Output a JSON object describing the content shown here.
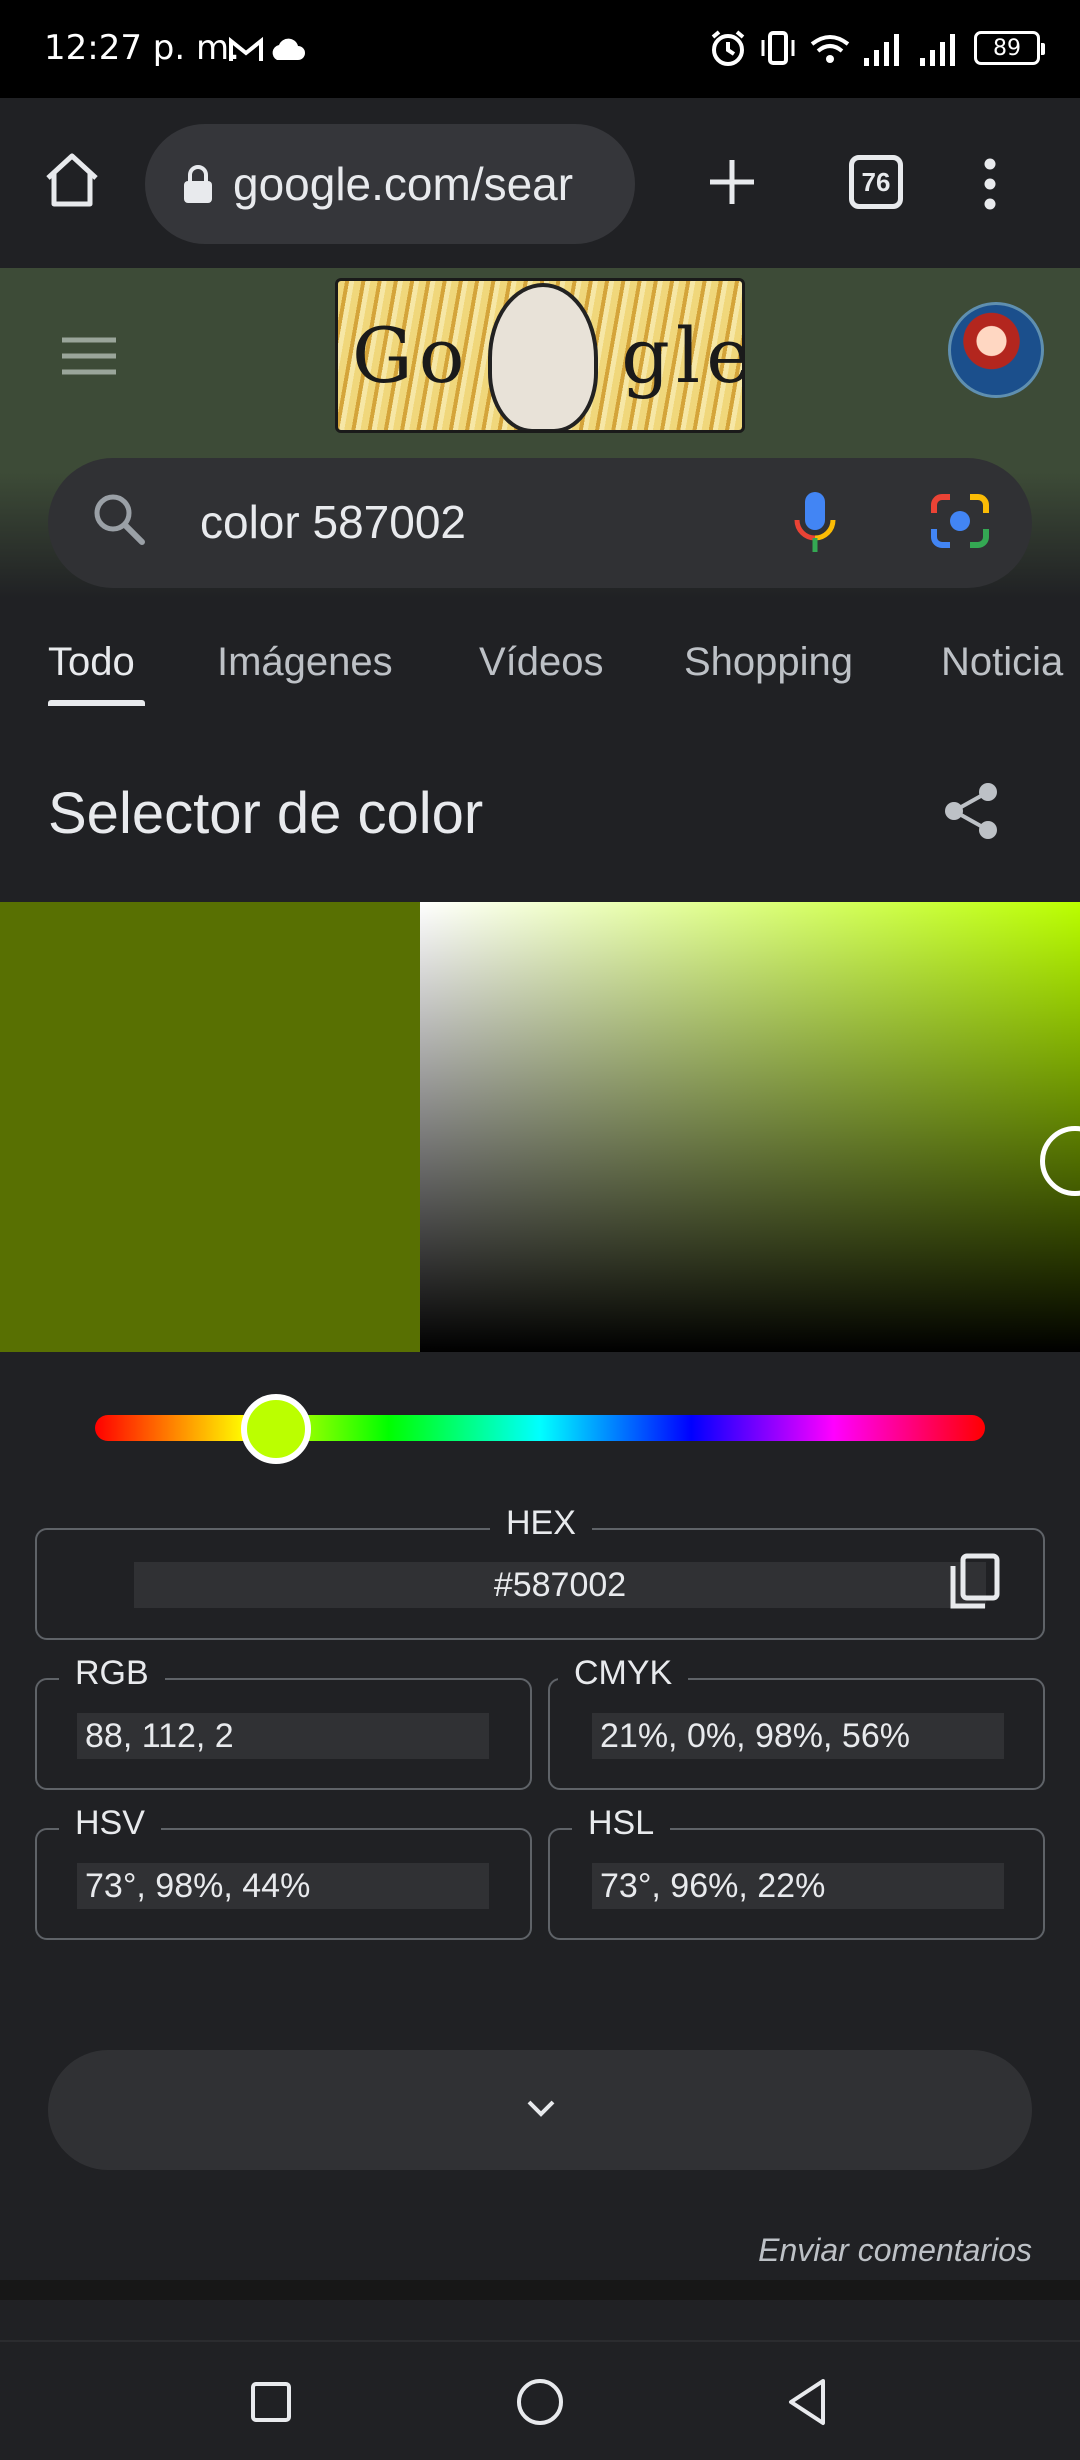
{
  "status_bar": {
    "time": "12:27 p. m.",
    "battery": "89"
  },
  "browser": {
    "url": "google.com/sear",
    "tab_count": "76"
  },
  "search": {
    "query": "color 587002"
  },
  "tabs": [
    {
      "label": "Todo",
      "active": true
    },
    {
      "label": "Imágenes"
    },
    {
      "label": "Vídeos"
    },
    {
      "label": "Shopping"
    },
    {
      "label": "Noticia"
    }
  ],
  "picker": {
    "title": "Selector de color",
    "selected_color": "#587002",
    "hue_color": "#bbff00",
    "hue_fraction": 0.203,
    "hex": {
      "label": "HEX",
      "value": "#587002"
    },
    "rgb": {
      "label": "RGB",
      "value": "88, 112, 2"
    },
    "cmyk": {
      "label": "CMYK",
      "value": "21%, 0%, 98%, 56%"
    },
    "hsv": {
      "label": "HSV",
      "value": "73°, 98%, 44%"
    },
    "hsl": {
      "label": "HSL",
      "value": "73°, 96%, 22%"
    },
    "feedback": "Enviar comentarios"
  },
  "colors": {
    "header_bg": "#3d4b37",
    "page_bg": "#202124"
  }
}
